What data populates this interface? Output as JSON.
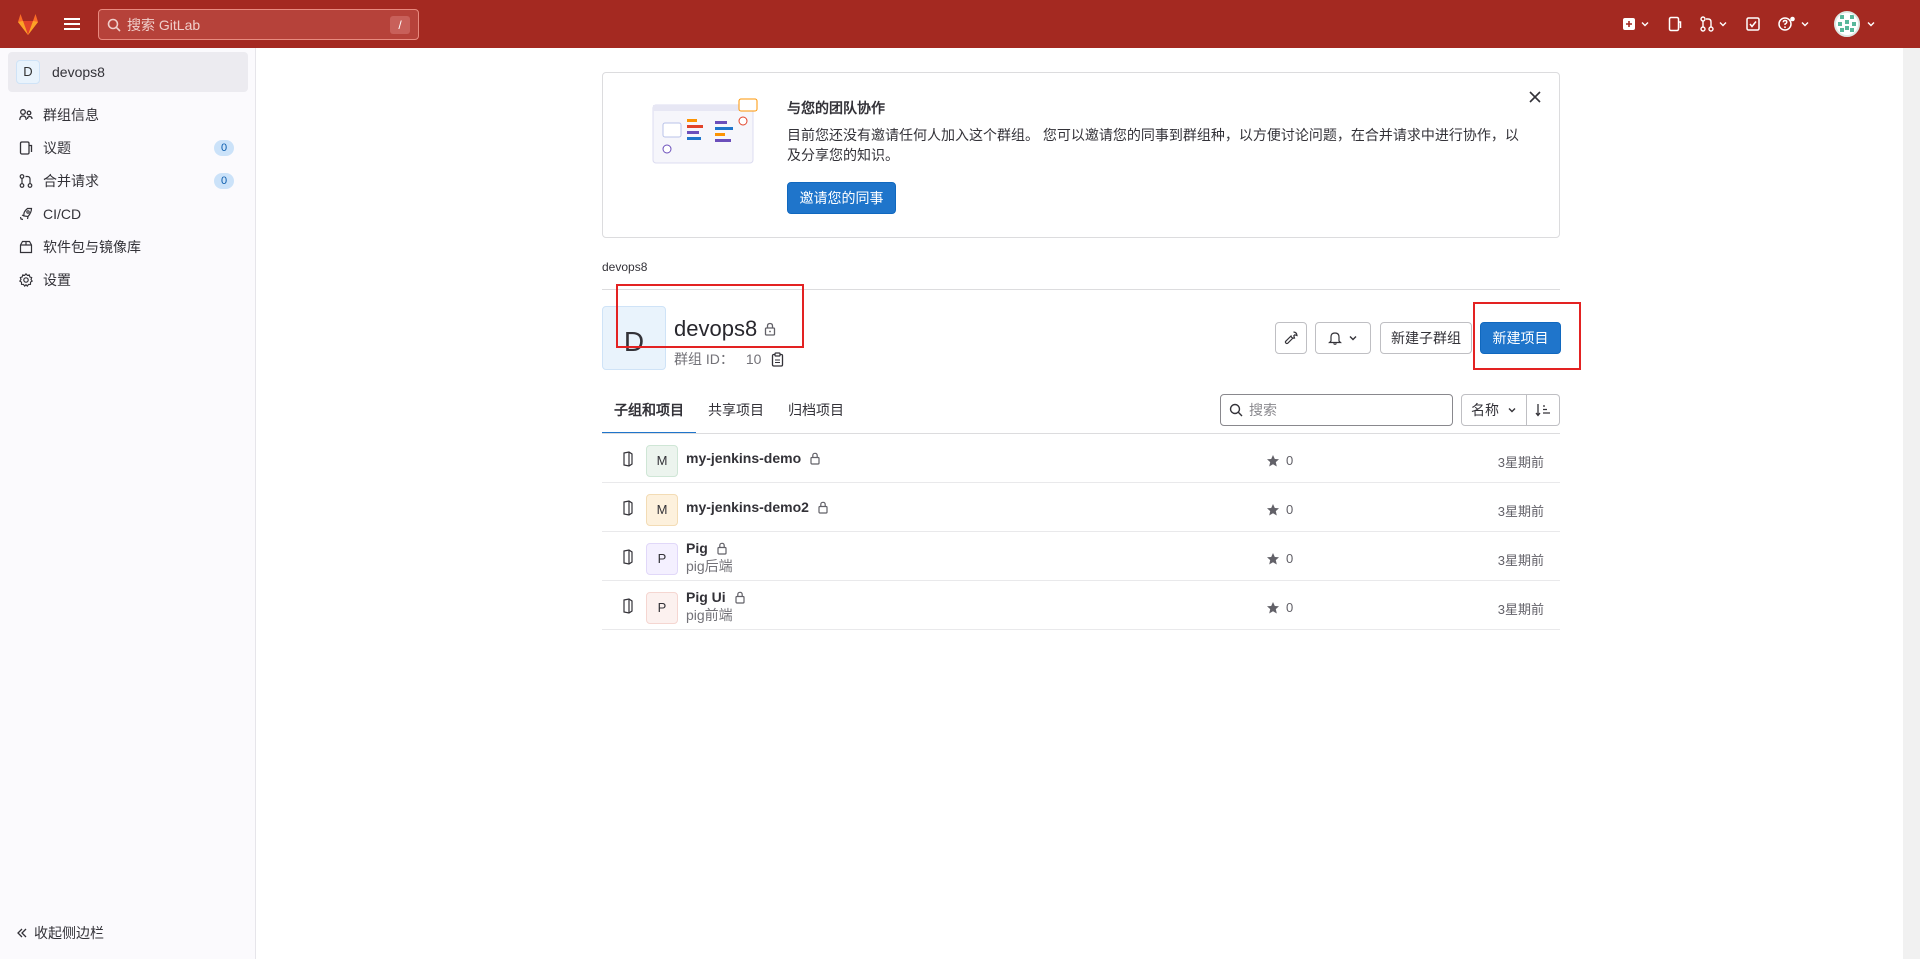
{
  "topbar": {
    "search_placeholder": "搜索 GitLab",
    "search_shortcut": "/"
  },
  "sidebar": {
    "context": {
      "avatar_letter": "D",
      "name": "devops8"
    },
    "items": [
      {
        "label": "群组信息",
        "icon": "group-icon"
      },
      {
        "label": "议题",
        "icon": "issues-icon",
        "count": "0"
      },
      {
        "label": "合并请求",
        "icon": "merge-request-icon",
        "count": "0"
      },
      {
        "label": "CI/CD",
        "icon": "rocket-icon"
      },
      {
        "label": "软件包与镜像库",
        "icon": "package-icon"
      },
      {
        "label": "设置",
        "icon": "settings-icon"
      }
    ],
    "collapse_label": "收起侧边栏"
  },
  "invite_alert": {
    "title": "与您的团队协作",
    "body": "目前您还没有邀请任何人加入这个群组。 您可以邀请您的同事到群组种，以方便讨论问题，在合并请求中进行协作，以及分享您的知识。",
    "button": "邀请您的同事"
  },
  "breadcrumb": "devops8",
  "group": {
    "avatar_letter": "D",
    "name": "devops8",
    "id_label": "群组 ID：",
    "id_value": "10"
  },
  "actions": {
    "new_subgroup": "新建子群组",
    "new_project": "新建项目"
  },
  "tabs": [
    {
      "label": "子组和项目",
      "active": true
    },
    {
      "label": "共享项目",
      "active": false
    },
    {
      "label": "归档项目",
      "active": false
    }
  ],
  "list_search_placeholder": "搜索",
  "sort_label": "名称",
  "projects": [
    {
      "avatar_letter": "M",
      "avatar_bg": "#ecf4ee",
      "avatar_border": "#cfe6d6",
      "name": "my-jenkins-demo",
      "description": "",
      "stars": "0",
      "updated": "3星期前"
    },
    {
      "avatar_letter": "M",
      "avatar_bg": "#fdf1dd",
      "avatar_border": "#f3dcb5",
      "name": "my-jenkins-demo2",
      "description": "",
      "stars": "0",
      "updated": "3星期前"
    },
    {
      "avatar_letter": "P",
      "avatar_bg": "#f4f0ff",
      "avatar_border": "#e1d8f9",
      "name": "Pig",
      "description": "pig后端",
      "stars": "0",
      "updated": "3星期前"
    },
    {
      "avatar_letter": "P",
      "avatar_bg": "#fcf1ef",
      "avatar_border": "#f5d6d1",
      "name": "Pig Ui",
      "description": "pig前端",
      "stars": "0",
      "updated": "3星期前"
    }
  ],
  "colors": {
    "topbar": "#a42921",
    "primary": "#1f75cb",
    "annotation": "#e32222"
  }
}
